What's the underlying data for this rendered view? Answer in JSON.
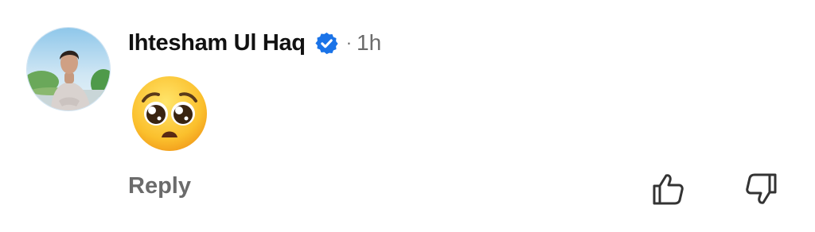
{
  "comment": {
    "author": "Ihtesham Ul Haq",
    "verified": true,
    "separator": "·",
    "timestamp": "1h",
    "body_emoji": "pleading-face",
    "reply_label": "Reply"
  },
  "icons": {
    "verified": "verified-badge-icon",
    "like": "thumbs-up-icon",
    "dislike": "thumbs-down-icon"
  },
  "colors": {
    "verified_badge": "#1a73e8",
    "author_text": "#111111",
    "meta_text": "#6b6b6b",
    "background": "#ffffff"
  }
}
